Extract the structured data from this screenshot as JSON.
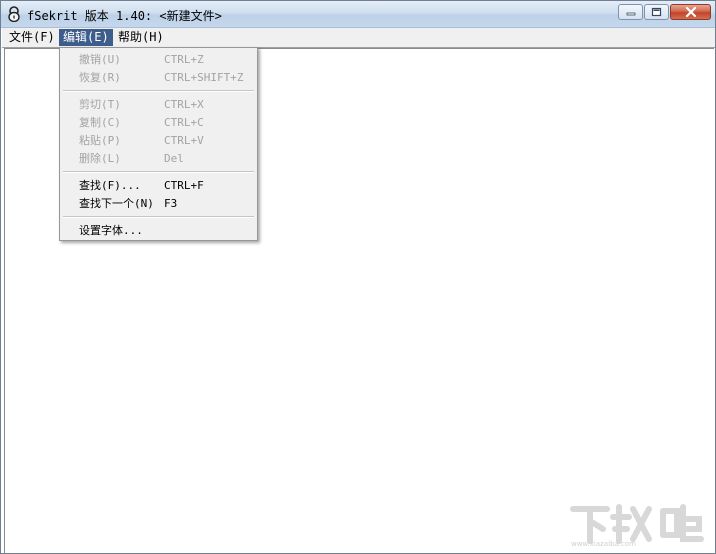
{
  "window": {
    "title": "fSekrit 版本 1.40: <新建文件>"
  },
  "menubar": {
    "file": "文件(F)",
    "edit": "编辑(E)",
    "help": "帮助(H)"
  },
  "edit_menu": {
    "items": [
      {
        "label": "撤销(U)",
        "shortcut": "CTRL+Z",
        "enabled": false
      },
      {
        "label": "恢复(R)",
        "shortcut": "CTRL+SHIFT+Z",
        "enabled": false
      },
      {
        "label": "剪切(T)",
        "shortcut": "CTRL+X",
        "enabled": false
      },
      {
        "label": "复制(C)",
        "shortcut": "CTRL+C",
        "enabled": false
      },
      {
        "label": "粘贴(P)",
        "shortcut": "CTRL+V",
        "enabled": false
      },
      {
        "label": "删除(L)",
        "shortcut": "Del",
        "enabled": false
      },
      {
        "label": "查找(F)...",
        "shortcut": "CTRL+F",
        "enabled": true
      },
      {
        "label": "查找下一个(N)",
        "shortcut": "F3",
        "enabled": true
      },
      {
        "label": "设置字体...",
        "shortcut": "",
        "enabled": true
      }
    ]
  },
  "watermark": {
    "text": "下载吧"
  },
  "colors": {
    "menu_active": "#3d5d8c",
    "disabled_text": "#a3a3a3",
    "close_button": "#c2442a"
  }
}
